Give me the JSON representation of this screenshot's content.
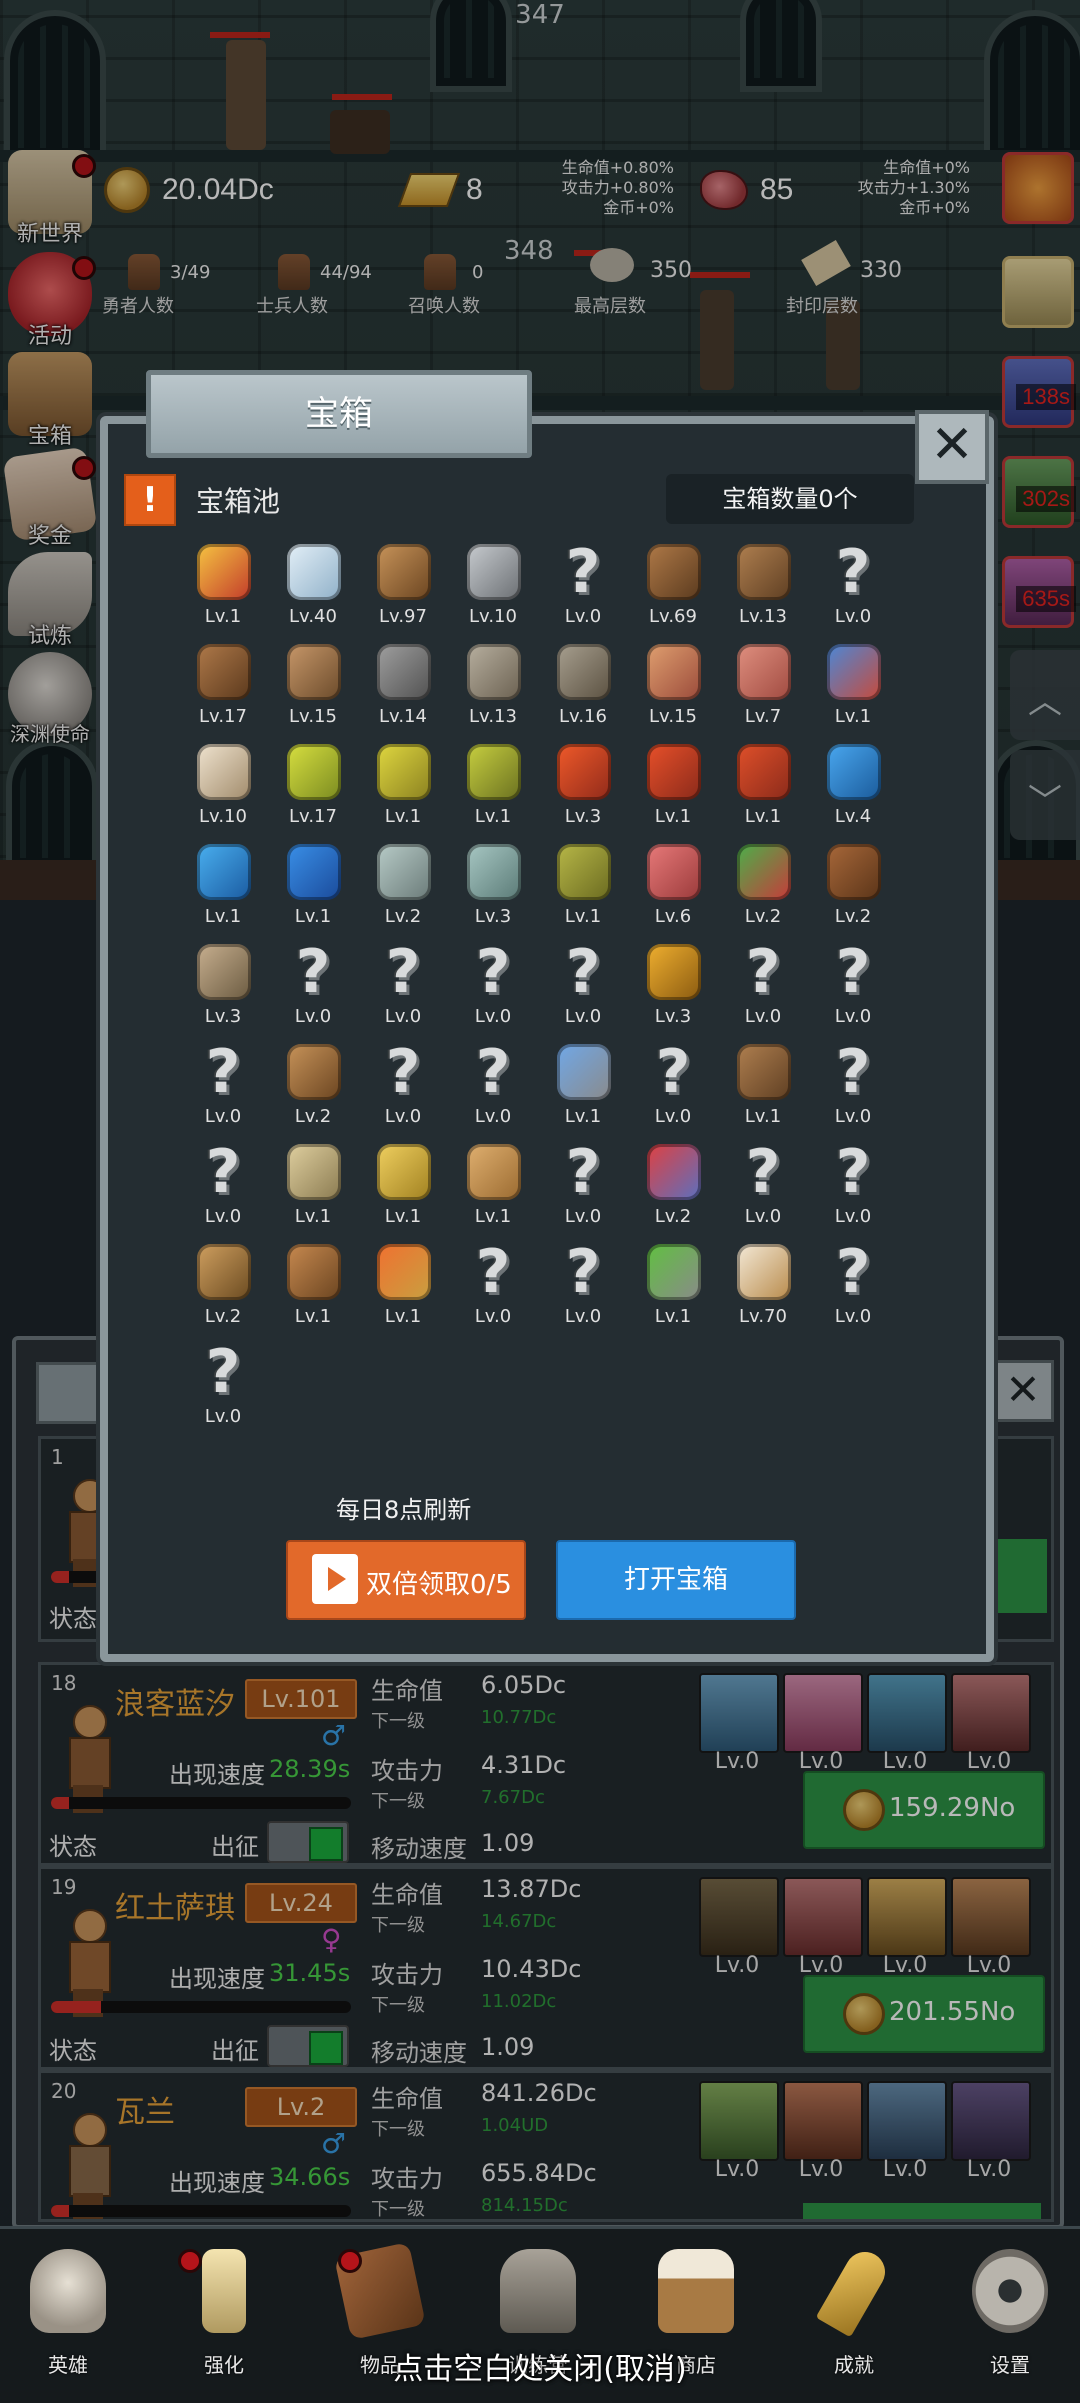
{
  "top_counter": "347",
  "mid_counter": "348",
  "resources": {
    "gold": "20.04Dc",
    "bars": "8",
    "meat": "85",
    "bars_bonus": [
      "生命值+0.80%",
      "攻击力+0.80%",
      "金币+0%"
    ],
    "meat_bonus": [
      "生命值+0%",
      "攻击力+1.30%",
      "金币+0%"
    ]
  },
  "counts": [
    {
      "value": "3/49",
      "label": "勇者人数"
    },
    {
      "value": "44/94",
      "label": "士兵人数"
    },
    {
      "value": "0",
      "label": "召唤人数"
    },
    {
      "value": "350",
      "label": "最高层数"
    },
    {
      "value": "330",
      "label": "封印层数"
    }
  ],
  "side_menu": [
    "新世界",
    "活动",
    "宝箱",
    "奖金",
    "试炼",
    "深渊使命"
  ],
  "timers": [
    "138s",
    "302s",
    "635s"
  ],
  "dialog": {
    "title": "宝箱",
    "pool_label": "宝箱池",
    "chest_count": "宝箱数量0个",
    "refresh_note": "每日8点刷新",
    "double_button": "双倍领取0/5",
    "open_button": "打开宝箱"
  },
  "items": [
    {
      "icon": "crown-icon",
      "lv": "Lv.1"
    },
    {
      "icon": "diamond-icon",
      "lv": "Lv.40"
    },
    {
      "icon": "bronze-sword-icon",
      "lv": "Lv.97"
    },
    {
      "icon": "iron-sword-icon",
      "lv": "Lv.10"
    },
    {
      "icon": "unknown-item-icon",
      "lv": "Lv.0"
    },
    {
      "icon": "leather-armor-icon",
      "lv": "Lv.69"
    },
    {
      "icon": "backpack-icon",
      "lv": "Lv.13"
    },
    {
      "icon": "unknown-item-icon",
      "lv": "Lv.0"
    },
    {
      "icon": "leather-helmet-icon",
      "lv": "Lv.17"
    },
    {
      "icon": "dagger-icon",
      "lv": "Lv.15"
    },
    {
      "icon": "knight-helmet-icon",
      "lv": "Lv.14"
    },
    {
      "icon": "hammer-icon",
      "lv": "Lv.13"
    },
    {
      "icon": "great-helm-icon",
      "lv": "Lv.16"
    },
    {
      "icon": "ham-icon",
      "lv": "Lv.15"
    },
    {
      "icon": "steak-icon",
      "lv": "Lv.7"
    },
    {
      "icon": "blue-pouch-icon",
      "lv": "Lv.1"
    },
    {
      "icon": "flour-bowl-icon",
      "lv": "Lv.10"
    },
    {
      "icon": "yellow-potion-icon",
      "lv": "Lv.17"
    },
    {
      "icon": "yellow-flask-icon",
      "lv": "Lv.1"
    },
    {
      "icon": "yellow-round-potion-icon",
      "lv": "Lv.1"
    },
    {
      "icon": "red-potion-icon",
      "lv": "Lv.3"
    },
    {
      "icon": "red-flask-icon",
      "lv": "Lv.1"
    },
    {
      "icon": "red-round-potion-icon",
      "lv": "Lv.1"
    },
    {
      "icon": "blue-potion-icon",
      "lv": "Lv.4"
    },
    {
      "icon": "blue-flask-icon",
      "lv": "Lv.1"
    },
    {
      "icon": "blue-round-potion-icon",
      "lv": "Lv.1"
    },
    {
      "icon": "empty-bottle-icon",
      "lv": "Lv.2"
    },
    {
      "icon": "glass-vial-icon",
      "lv": "Lv.3"
    },
    {
      "icon": "olive-bottle-icon",
      "lv": "Lv.1"
    },
    {
      "icon": "pink-vial-icon",
      "lv": "Lv.6"
    },
    {
      "icon": "winged-boots-icon",
      "lv": "Lv.2"
    },
    {
      "icon": "leather-boot-icon",
      "lv": "Lv.2"
    },
    {
      "icon": "worn-boot-icon",
      "lv": "Lv.3"
    },
    {
      "icon": "unknown-item-icon",
      "lv": "Lv.0"
    },
    {
      "icon": "unknown-item-icon",
      "lv": "Lv.0"
    },
    {
      "icon": "unknown-item-icon",
      "lv": "Lv.0"
    },
    {
      "icon": "unknown-item-icon",
      "lv": "Lv.0"
    },
    {
      "icon": "torch-wand-icon",
      "lv": "Lv.3"
    },
    {
      "icon": "unknown-item-icon",
      "lv": "Lv.0"
    },
    {
      "icon": "unknown-item-icon",
      "lv": "Lv.0"
    },
    {
      "icon": "unknown-item-icon",
      "lv": "Lv.0"
    },
    {
      "icon": "wooden-staff-icon",
      "lv": "Lv.2"
    },
    {
      "icon": "unknown-item-icon",
      "lv": "Lv.0"
    },
    {
      "icon": "unknown-item-icon",
      "lv": "Lv.0"
    },
    {
      "icon": "sapphire-scepter-icon",
      "lv": "Lv.1"
    },
    {
      "icon": "unknown-item-icon",
      "lv": "Lv.0"
    },
    {
      "icon": "satchel-icon",
      "lv": "Lv.1"
    },
    {
      "icon": "unknown-item-icon",
      "lv": "Lv.0"
    },
    {
      "icon": "unknown-item-icon",
      "lv": "Lv.0"
    },
    {
      "icon": "spiked-club-icon",
      "lv": "Lv.1"
    },
    {
      "icon": "cheese-icon",
      "lv": "Lv.1"
    },
    {
      "icon": "pie-icon",
      "lv": "Lv.1"
    },
    {
      "icon": "unknown-item-icon",
      "lv": "Lv.0"
    },
    {
      "icon": "red-orb-icon",
      "lv": "Lv.2"
    },
    {
      "icon": "unknown-item-icon",
      "lv": "Lv.0"
    },
    {
      "icon": "unknown-item-icon",
      "lv": "Lv.0"
    },
    {
      "icon": "bow-icon",
      "lv": "Lv.2"
    },
    {
      "icon": "quiver-icon",
      "lv": "Lv.1"
    },
    {
      "icon": "flame-tome-icon",
      "lv": "Lv.1"
    },
    {
      "icon": "unknown-item-icon",
      "lv": "Lv.0"
    },
    {
      "icon": "unknown-item-icon",
      "lv": "Lv.0"
    },
    {
      "icon": "green-orb-wand-icon",
      "lv": "Lv.1"
    },
    {
      "icon": "ale-mug-icon",
      "lv": "Lv.70"
    },
    {
      "icon": "unknown-item-icon",
      "lv": "Lv.0"
    },
    {
      "icon": "unknown-item-icon",
      "lv": "Lv.0"
    }
  ],
  "heroes": [
    {
      "num": "18",
      "name": "浪客蓝汐",
      "level": "Lv.101",
      "gender": "♂",
      "gender_color": "#3aa0e8",
      "speed_label": "出现速度",
      "speed": "28.39s",
      "hp_label": "生命值",
      "hp": "6.05Dc",
      "hp_next": "10.77Dc",
      "atk_label": "攻击力",
      "atk": "4.31Dc",
      "atk_next": "7.67Dc",
      "move_label": "移动速度",
      "move": "1.09",
      "next_label": "下一级",
      "status": "状态",
      "deploy": "出征",
      "skills": [
        "Lv.0",
        "Lv.0",
        "Lv.0",
        "Lv.0"
      ],
      "cost": "159.29No"
    },
    {
      "num": "19",
      "name": "红土萨琪",
      "level": "Lv.24",
      "gender": "♀",
      "gender_color": "#d050c8",
      "speed_label": "出现速度",
      "speed": "31.45s",
      "hp_label": "生命值",
      "hp": "13.87Dc",
      "hp_next": "14.67Dc",
      "atk_label": "攻击力",
      "atk": "10.43Dc",
      "atk_next": "11.02Dc",
      "move_label": "移动速度",
      "move": "1.09",
      "next_label": "下一级",
      "status": "状态",
      "deploy": "出征",
      "skills": [
        "Lv.0",
        "Lv.0",
        "Lv.0",
        "Lv.0"
      ],
      "cost": "201.55No"
    },
    {
      "num": "20",
      "name": "瓦兰",
      "level": "Lv.2",
      "gender": "♂",
      "gender_color": "#3aa0e8",
      "speed_label": "出现速度",
      "speed": "34.66s",
      "hp_label": "生命值",
      "hp": "841.26Dc",
      "hp_next": "1.04UD",
      "atk_label": "攻击力",
      "atk": "655.84Dc",
      "atk_next": "814.15Dc",
      "move_label": "移动速度",
      "move": "",
      "next_label": "下一级",
      "status": "",
      "deploy": "",
      "skills": [
        "Lv.0",
        "Lv.0",
        "Lv.0",
        "Lv.0"
      ],
      "cost": ""
    }
  ],
  "first_card": {
    "num": "1",
    "status": "状态"
  },
  "bottom_nav": [
    "英雄",
    "强化",
    "物品",
    "训练营",
    "商店",
    "成就",
    "设置"
  ],
  "close_hint": "点击空白处关闭(取消)",
  "colors": {
    "accent_orange": "#e2692a",
    "accent_blue": "#2a8fe0",
    "green_button": "#2d9446",
    "hero_name": "#e8a33a",
    "timer_red": "#e6231f"
  }
}
